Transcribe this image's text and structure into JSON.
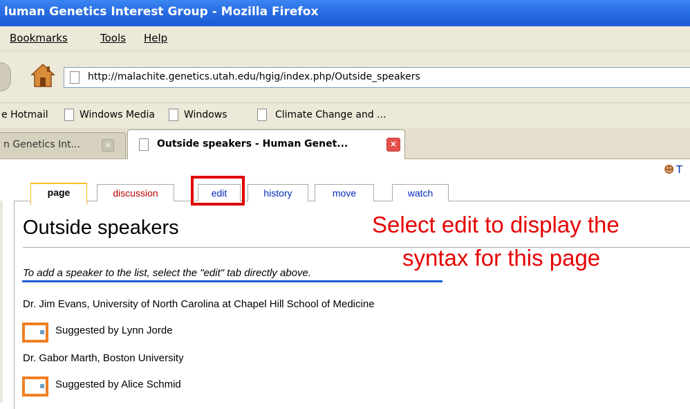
{
  "window": {
    "title": "luman Genetics Interest Group - Mozilla Firefox"
  },
  "menu": {
    "items": [
      "Bookmarks",
      "Tools",
      "Help"
    ]
  },
  "nav": {
    "url": "http://malachite.genetics.utah.edu/hgig/index.php/Outside_speakers"
  },
  "bookmarks": {
    "items": [
      "e Hotmail",
      "Windows Media",
      "Windows",
      "Climate Change and ..."
    ]
  },
  "tabs": [
    {
      "label": "n Genetics Int...",
      "close": "×"
    },
    {
      "label": "Outside speakers - Human Genet...",
      "close": "×"
    }
  ],
  "user": {
    "icon": "user-icon",
    "text": "T"
  },
  "page_tabs": [
    "page",
    "discussion",
    "edit",
    "history",
    "move",
    "watch"
  ],
  "article": {
    "heading": "Outside speakers",
    "instruction": "To add a speaker to the list, select the \"edit\" tab directly above.",
    "entries": [
      {
        "speaker": "Dr. Jim Evans, University of North Carolina at Chapel Hill School of Medicine",
        "suggested": "Suggested by Lynn Jorde"
      },
      {
        "speaker": "Dr. Gabor Marth, Boston University",
        "suggested": "Suggested by Alice Schmid"
      }
    ]
  },
  "annotation": {
    "callout_line1": "Select edit to display the",
    "callout_line2": "syntax for this page"
  },
  "colors": {
    "titlebar": "#2a6fe4",
    "highlight_red": "#e00000",
    "highlight_orange": "#f07f23",
    "underline_blue": "#1b5bd8",
    "callout_text": "#e60000"
  }
}
